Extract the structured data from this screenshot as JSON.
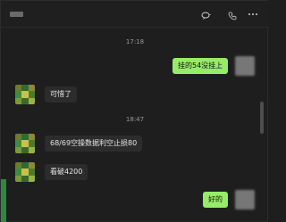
{
  "messages": [
    {
      "time": "17:18"
    },
    {
      "direction": "out",
      "text": "挂的54没挂上"
    },
    {
      "direction": "in",
      "text": "可惜了"
    },
    {
      "time": "18:47"
    },
    {
      "direction": "in",
      "text": "68/69空操数据利空止损80"
    },
    {
      "direction": "in",
      "text": "看破4200"
    },
    {
      "direction": "out",
      "text": "好的"
    }
  ],
  "header": {
    "icons": [
      "chat-bubble-icon",
      "phone-icon",
      "more-icon"
    ]
  },
  "colors": {
    "bg": "#1e1e1e",
    "bubble_in": "#2c2c2c",
    "bubble_out": "#95ec69"
  }
}
